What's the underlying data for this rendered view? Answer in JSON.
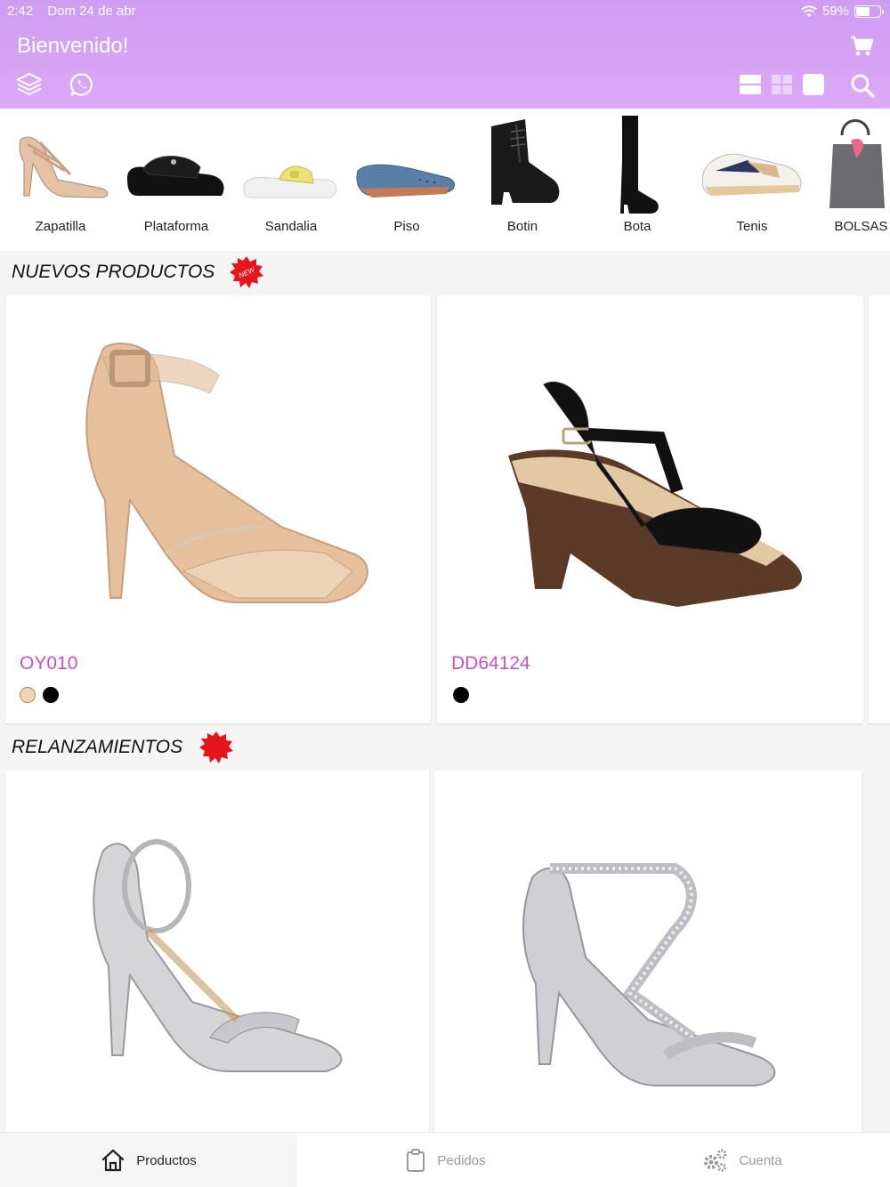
{
  "status": {
    "time": "2:42",
    "date": "Dom 24 de abr",
    "battery": "59%",
    "battery_level": 0.59
  },
  "header": {
    "title": "Bienvenido!",
    "accent": "#d9a6f5"
  },
  "categories": [
    {
      "label": "Zapatilla"
    },
    {
      "label": "Plataforma"
    },
    {
      "label": "Sandalia"
    },
    {
      "label": "Piso"
    },
    {
      "label": "Botin"
    },
    {
      "label": "Bota"
    },
    {
      "label": "Tenis"
    },
    {
      "label": "BOLSAS D"
    }
  ],
  "sections": {
    "new": {
      "title": "NUEVOS PRODUCTOS",
      "badge_color": "#e8141b"
    },
    "relaunch": {
      "title": "RELANZAMIENTOS",
      "badge_color": "#e8141b"
    }
  },
  "products_new": [
    {
      "code": "OY010",
      "colors": [
        "#f6d2ae",
        "#000000"
      ]
    },
    {
      "code": "DD64124",
      "colors": [
        "#000000"
      ]
    }
  ],
  "tabs": [
    {
      "label": "Productos",
      "active": true
    },
    {
      "label": "Pedidos",
      "active": false
    },
    {
      "label": "Cuenta",
      "active": false
    }
  ],
  "colors": {
    "code_text": "#c751c9"
  }
}
